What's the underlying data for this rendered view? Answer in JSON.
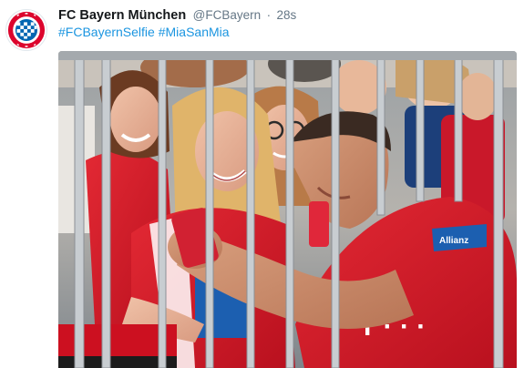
{
  "tweet": {
    "author": {
      "display_name": "FC Bayern München",
      "handle": "@FCBayern",
      "avatar": {
        "icon": "fc-bayern-crest-icon",
        "lettering": "FC BAYERN MÜNCHEN"
      }
    },
    "separator": "·",
    "timestamp": "28s",
    "hashtags": [
      "#FCBayernSelfie",
      "#MiaSanMia"
    ],
    "media": {
      "kind": "photo",
      "jersey_sponsor_lettering": "T · · ·",
      "sleeve_patch_lettering": "Allianz"
    }
  },
  "colors": {
    "name_text": "#14171a",
    "meta_text": "#657786",
    "hashtag": "#1b95e0",
    "bayern_red": "#dc052d",
    "bayern_blue": "#0066b2"
  }
}
